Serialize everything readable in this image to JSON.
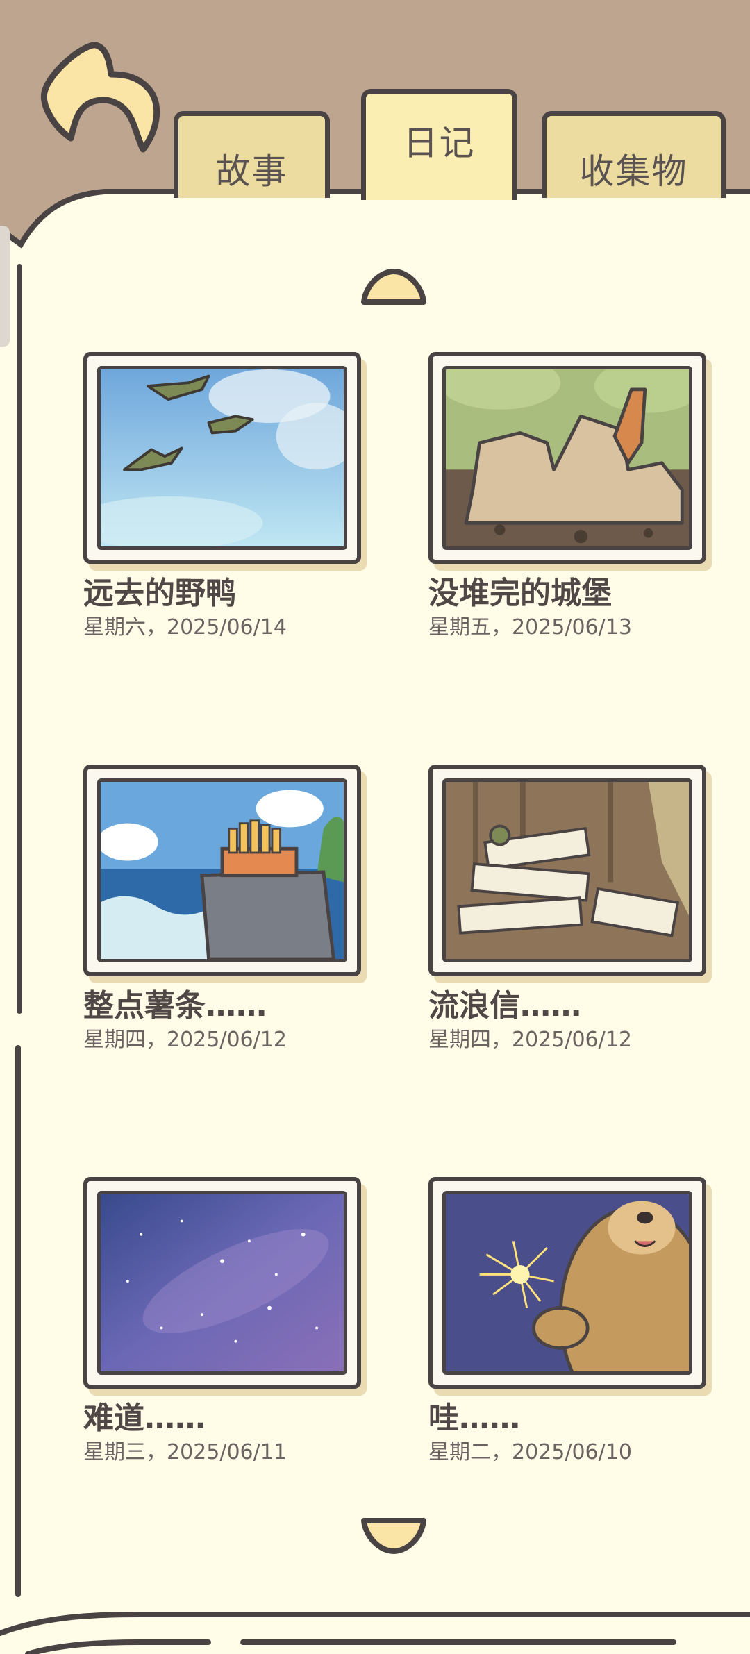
{
  "tabs": [
    {
      "label": "故事",
      "active": false
    },
    {
      "label": "日记",
      "active": true
    },
    {
      "label": "收集物",
      "active": false
    }
  ],
  "icons": {
    "back": "back-arrow-icon",
    "page_up": "chevron-up-icon",
    "page_down": "chevron-down-icon"
  },
  "colors": {
    "background": "#bda58f",
    "paper": "#fffde8",
    "outline": "#4a4343",
    "tab_active": "#fbeeb3",
    "tab_inactive": "#ecdca0",
    "accent_yellow": "#fbe5a6"
  },
  "diary": {
    "entries": [
      {
        "title": "远去的野鸭",
        "date": "星期六，2025/06/14",
        "picture": "flying-ducks-sky"
      },
      {
        "title": "没堆完的城堡",
        "date": "星期五，2025/06/13",
        "picture": "sand-castle-shovel"
      },
      {
        "title": "整点薯条……",
        "date": "星期四，2025/06/12",
        "picture": "fries-on-seaside-cliff"
      },
      {
        "title": "流浪信……",
        "date": "星期四，2025/06/12",
        "picture": "pile-of-letters"
      },
      {
        "title": "难道……",
        "date": "星期三，2025/06/11",
        "picture": "starry-night-sky"
      },
      {
        "title": "哇……",
        "date": "星期二，2025/06/10",
        "picture": "bear-holding-sparkler"
      }
    ]
  }
}
